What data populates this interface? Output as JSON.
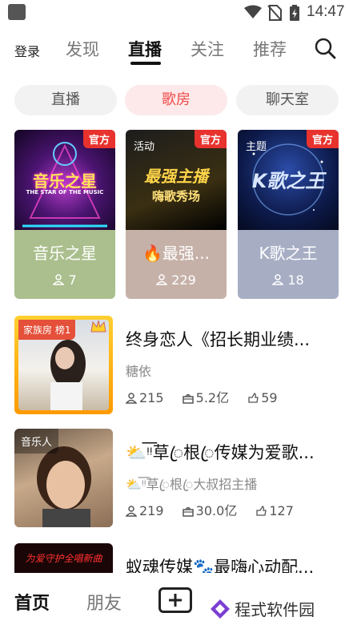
{
  "status_bar": {
    "time": "14:47",
    "icons": [
      "app-icon",
      "wifi-icon",
      "no-sim-icon",
      "battery-icon"
    ]
  },
  "top_nav": {
    "login": "登录",
    "tabs": [
      "发现",
      "直播",
      "关注",
      "推荐"
    ],
    "active_tab": "直播",
    "search_icon": "search-icon"
  },
  "chips": {
    "items": [
      "直播",
      "歌房",
      "聊天室"
    ],
    "active": "歌房"
  },
  "cards": [
    {
      "badge": "官方",
      "tag": "",
      "art_title": "音乐之星",
      "art_subtitle": "THE STAR OF THE MUSIC",
      "title": "音乐之星",
      "count": "7",
      "foot_color": "#aabf8d"
    },
    {
      "badge": "官方",
      "tag": "活动",
      "art_title": "最强主播",
      "art_subtitle": "嗨歌秀场",
      "title": "最强...",
      "count": "229",
      "foot_color": "#c6b1a8"
    },
    {
      "badge": "官方",
      "tag": "主题",
      "art_title": "K歌之王",
      "art_subtitle": "",
      "title": "K歌之王",
      "count": "18",
      "foot_color": "#a7aec4"
    }
  ],
  "rooms": [
    {
      "thumb_tag": "家族房 榜1",
      "title": "终身恋人《招长期业绩...",
      "subtitle": "糖依",
      "users": "215",
      "gifts": "5.2亿",
      "likes": "59"
    },
    {
      "thumb_tag": "音乐人",
      "title": "⛅️ᵎ͞ᵎ草ꦿ根ꦿ传媒为爱歌...",
      "subtitle": "⛅️ᵎ͞ᵎ草ꦿ根ꦿ大叔招主播",
      "users": "219",
      "gifts": "30.0亿",
      "likes": "127"
    },
    {
      "thumb_tag": "",
      "title": "蚁魂传媒🐾最嗨心动配...",
      "subtitle": "",
      "users": "",
      "gifts": "",
      "likes": ""
    }
  ],
  "bottom_bar": {
    "home": "首页",
    "friends": "朋友",
    "watermark": "程式软件园"
  }
}
